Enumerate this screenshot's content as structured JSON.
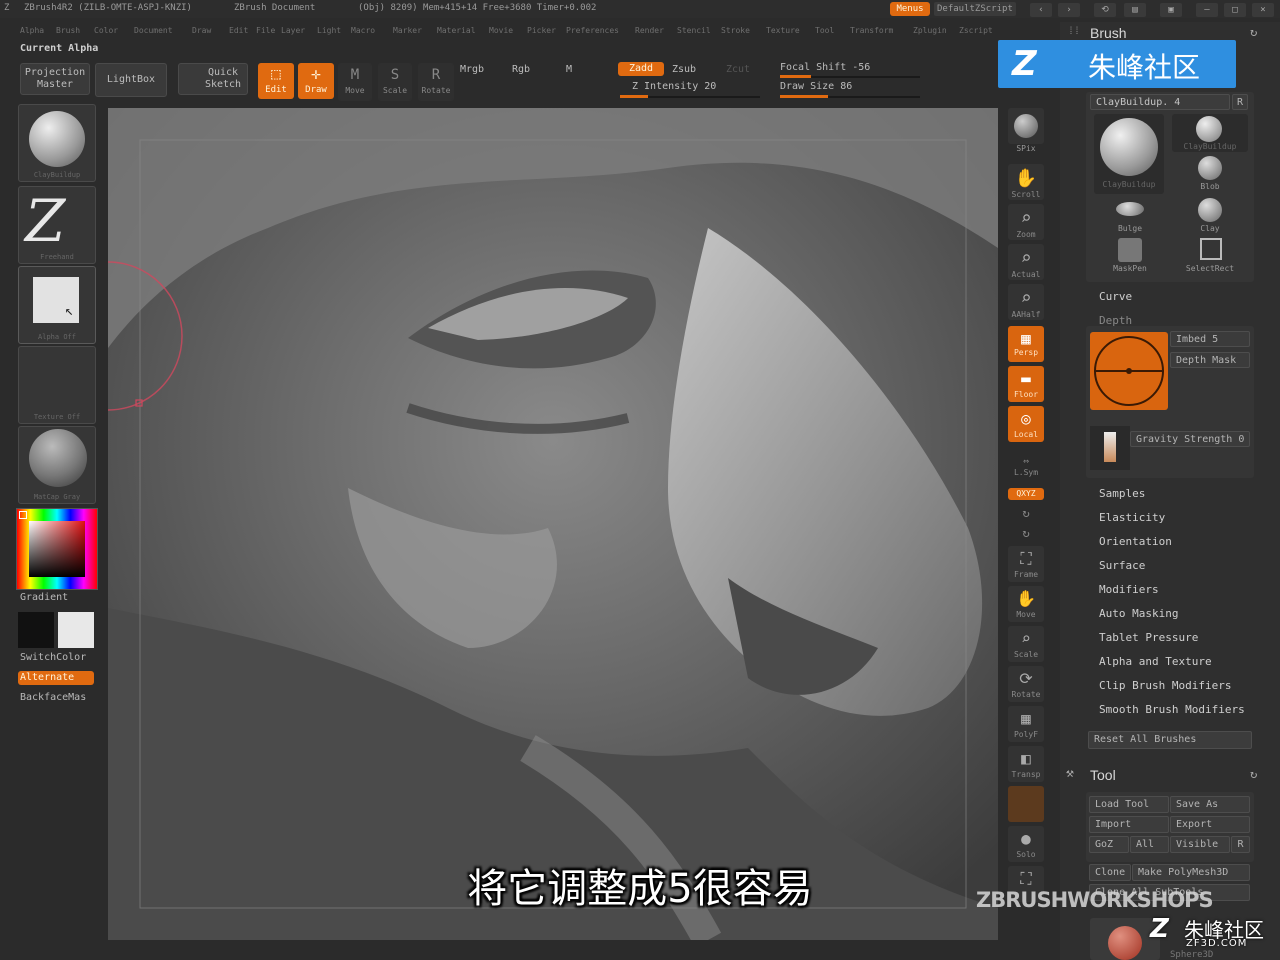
{
  "titlebar": {
    "app": "ZBrush4R2 (ZILB-OMTE-ASPJ-KNZI)",
    "document": "ZBrush Document",
    "stats": "(Obj) 8209) Mem+415+14 Free+3680 Timer+0.002",
    "menus_btn": "Menus",
    "script_btn": "DefaultZScript"
  },
  "menubar": {
    "items": [
      "Alpha",
      "Brush",
      "Color",
      "Document",
      "Draw",
      "Edit",
      "File",
      "Layer",
      "Light",
      "Macro",
      "Marker",
      "Material",
      "Movie",
      "Picker",
      "Preferences",
      "Render",
      "Stencil",
      "Stroke",
      "Texture",
      "Tool",
      "Transform",
      "Zplugin",
      "Zscript"
    ]
  },
  "current_palette": "Current Alpha",
  "shelf": {
    "projection_master": "Projection Master",
    "lightbox": "LightBox",
    "quick_sketch": "Quick Sketch",
    "edit": "Edit",
    "draw": "Draw",
    "move": "Move",
    "scale": "Scale",
    "rotate": "Rotate",
    "mrgb": "Mrgb",
    "rgb": "Rgb",
    "m": "M",
    "zadd": "Zadd",
    "zsub": "Zsub",
    "zcut": "Zcut",
    "z_intensity": "Z Intensity 20",
    "focal_shift": "Focal Shift -56",
    "draw_size": "Draw Size 86",
    "focal_shift_value": -56,
    "z_intensity_value": 20,
    "draw_size_value": 86
  },
  "left_tray": {
    "brush_name": "ClayBuildup",
    "stroke_name": "Freehand",
    "alpha_name": "Alpha Off",
    "texture_name": "Texture Off",
    "material_name": "MatCap Gray",
    "gradient": "Gradient",
    "switch_color": "SwitchColor",
    "alternate": "Alternate",
    "backface": "BackfaceMas"
  },
  "right_tools": {
    "bpr": "BPR",
    "spix": "SPix",
    "scroll": "Scroll",
    "zoom": "Zoom",
    "actual": "Actual",
    "aahalf": "AAHalf",
    "persp": "Persp",
    "floor": "Floor",
    "local": "Local",
    "lsym": "L.Sym",
    "xyz": "QXYZ",
    "frame": "Frame",
    "move": "Move",
    "scale": "Scale",
    "rotate": "Rotate",
    "polyf": "PolyF",
    "transp": "Transp",
    "ghost": "Ghost",
    "solo": "Solo",
    "xpose": "Xpose"
  },
  "brush_panel": {
    "title": "Brush",
    "current": "ClayBuildup. 4",
    "r_btn": "R",
    "thumbs": [
      "ClayBuildup",
      "ClayBuildup",
      "Blob",
      "Bulge",
      "Clay",
      "MaskPen",
      "SelectRect"
    ],
    "curve": "Curve",
    "depth": "Depth",
    "imbed": "Imbed 5",
    "depth_mask": "Depth Mask",
    "gravity": "Gravity Strength 0",
    "sections": [
      "Samples",
      "Elasticity",
      "Orientation",
      "Surface",
      "Modifiers",
      "Auto Masking",
      "Tablet Pressure",
      "Alpha and Texture",
      "Clip Brush Modifiers",
      "Smooth Brush Modifiers"
    ],
    "reset": "Reset All Brushes"
  },
  "tool_panel": {
    "title": "Tool",
    "load_tool": "Load Tool",
    "save_as": "Save As",
    "import": "Import",
    "export": "Export",
    "goz": "GoZ",
    "all": "All",
    "visible": "Visible",
    "r": "R",
    "clone": "Clone",
    "make_polymesh": "Make PolyMesh3D",
    "clone_all": "Clone All SubTools",
    "current_tool": "Sphere3D"
  },
  "overlay": {
    "subtitle": "将它调整成5很容易",
    "watermark_top": "朱峰社区",
    "watermark_bottom_brand": "ZBRUSHWORKSHOPS",
    "watermark_bottom_site": "朱峰社区",
    "watermark_url": "ZF3D.COM"
  },
  "colors": {
    "accent": "#e06a10",
    "panel": "#2f2f2f",
    "background": "#2b2b2b"
  }
}
